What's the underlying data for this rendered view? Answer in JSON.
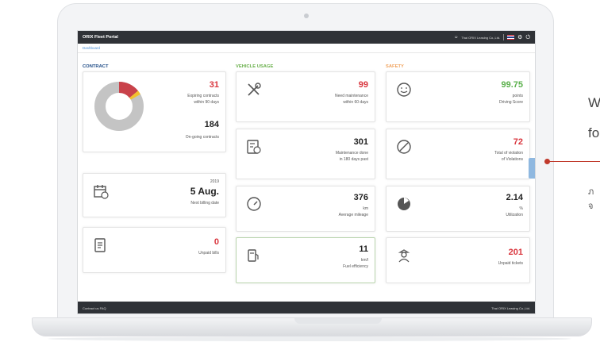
{
  "header": {
    "app_title": "ORIX Fleet Portal",
    "company": "Thai ORIX Leasing Co.,Ltd."
  },
  "breadcrumb": "Dashboard",
  "sections": {
    "contract": "CONTRACT",
    "usage": "VEHICLE USAGE",
    "safety": "SAFETY"
  },
  "contract": {
    "expiring_value": "31",
    "expiring_label": "Expiring contracts\nwithin 90 days",
    "ongoing_value": "184",
    "ongoing_label": "On-going contracts",
    "donut": {
      "expiring": 31,
      "ongoing": 184,
      "other": 6
    },
    "billing_year": "2019",
    "billing_date": "5 Aug.",
    "billing_label": "Next billing date",
    "unpaid_bills_value": "0",
    "unpaid_bills_label": "Unpaid bills"
  },
  "usage": {
    "maint_need_value": "99",
    "maint_need_label": "Need maintenance\nwithin 60 days",
    "maint_done_value": "301",
    "maint_done_label": "Maintenance done\nin 180 days past",
    "mileage_value": "376",
    "mileage_label": "km\nAverage mileage",
    "fuel_value": "11",
    "fuel_label": "km/l\nFuel efficiency"
  },
  "safety": {
    "score_value": "99.75",
    "score_label": "points\nDriving Score",
    "violation_value": "72",
    "violation_label": "Total of violation\nof Violations",
    "util_value": "2.14",
    "util_label": "%\nUtilization",
    "tickets_value": "201",
    "tickets_label": "Unpaid tickets"
  },
  "footer": {
    "left": "Contract us  FAQ",
    "right": "Thai ORIX Leasing Co.,Ltd."
  },
  "promo": {
    "line1": "W",
    "line2": "fo",
    "line3": "ภ",
    "line4": "จ"
  },
  "colors": {
    "topbar": "#2f3237",
    "red": "#d9363e",
    "green": "#5bb04c",
    "contract": "#1e4b86",
    "usage": "#6ab04c",
    "safety": "#f0a35e"
  }
}
